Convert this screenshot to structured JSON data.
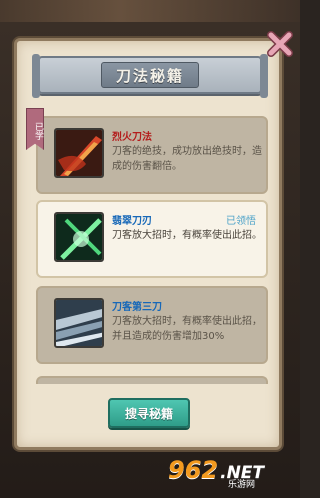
{
  "title": "刀法秘籍",
  "learned_tag": "已学",
  "skills": [
    {
      "name": "烈火刀法",
      "desc": "刀客的绝技，成功放出绝技时，造成的伤害翻倍。",
      "status": "",
      "name_color": "#b41c1c",
      "icon": "flame-blade-icon"
    },
    {
      "name": "翡翠刀刃",
      "desc": "刀客放大招时，有概率使出此招。",
      "status": "已领悟",
      "name_color": "#1768b8",
      "icon": "jade-blade-icon"
    },
    {
      "name": "刀客第三刀",
      "desc": "刀客放大招时，有概率使出此招，并且造成的伤害增加30%",
      "status": "",
      "name_color": "#1768b8",
      "icon": "steel-blade-icon"
    }
  ],
  "search_button": "搜寻秘籍",
  "watermark": {
    "digits": "962",
    "net": ".NET",
    "cn": "乐游网"
  },
  "colors": {
    "panel": "#ede3cf",
    "accent_button": "#2f9d89",
    "status_text": "#4aa1c8"
  }
}
